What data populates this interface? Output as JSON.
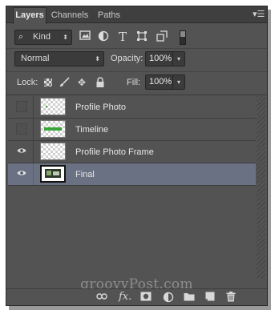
{
  "tabs": [
    {
      "label": "Layers",
      "active": true
    },
    {
      "label": "Channels",
      "active": false
    },
    {
      "label": "Paths",
      "active": false
    }
  ],
  "panel_menu_icon": "panel-menu-icon",
  "filter": {
    "kind_label": "Kind",
    "kind_icon": "search-icon",
    "icons": [
      "image-filter-icon",
      "adjustment-filter-icon",
      "type-filter-icon",
      "shape-filter-icon",
      "smart-object-filter-icon"
    ]
  },
  "blend": {
    "mode": "Normal",
    "opacity_label": "Opacity:",
    "opacity_value": "100%"
  },
  "lock": {
    "label": "Lock:",
    "icons": [
      "lock-transparent-pixels-icon",
      "lock-image-pixels-icon",
      "lock-position-icon",
      "lock-all-icon"
    ],
    "fill_label": "Fill:",
    "fill_value": "100%"
  },
  "layers": [
    {
      "name": "Profile Photo",
      "visible": false,
      "selected": false,
      "thumb": "checker-dot"
    },
    {
      "name": "Timeline",
      "visible": false,
      "selected": false,
      "thumb": "checker-bar"
    },
    {
      "name": "Profile Photo Frame",
      "visible": true,
      "selected": false,
      "thumb": "checker"
    },
    {
      "name": "Final",
      "visible": true,
      "selected": true,
      "thumb": "image"
    }
  ],
  "watermark": "groovyPost.com",
  "bottom_icons": [
    "link-layers-icon",
    "fx-icon",
    "layer-mask-icon",
    "adjustment-layer-icon",
    "new-group-icon",
    "new-layer-icon",
    "trash-icon"
  ],
  "colors": {
    "panel_bg": "#535353",
    "selected_row": "#6a7183",
    "timeline_green": "#3aa43a"
  }
}
